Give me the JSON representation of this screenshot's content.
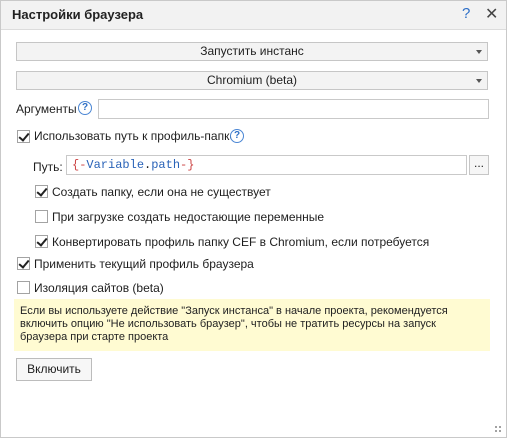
{
  "dialog": {
    "title": "Настройки браузера",
    "help_symbol": "?",
    "close_symbol": "✕"
  },
  "launch_combo": {
    "value": "Запустить инстанс"
  },
  "browser_combo": {
    "value": "Chromium (beta)"
  },
  "arguments": {
    "label": "Аргументы",
    "help": "?",
    "value": ""
  },
  "profile_folder": {
    "label": "Использовать путь к профиль-папке",
    "checked": true,
    "help": "?"
  },
  "path": {
    "label": "Путь:",
    "open_brace": "{-",
    "var_name": "Variable",
    "dot": ".",
    "var_field": "path",
    "close_brace": "-}",
    "browse_label": "..."
  },
  "options": [
    {
      "label": "Создать папку, если она не существует",
      "checked": true
    },
    {
      "label": "При загрузке создать недостающие переменные",
      "checked": false
    },
    {
      "label": "Конвертировать профиль папку CEF в Chromium, если потребуется",
      "checked": true
    },
    {
      "label": "Применить текущий профиль браузера",
      "checked": true
    },
    {
      "label": "Изоляция сайтов (beta)",
      "checked": false
    }
  ],
  "note": {
    "line1": "Если вы используете действие \"Запуск инстанса\" в начале проекта, рекомендуется",
    "line2": "включить опцию \"Не использовать браузер\", чтобы не тратить ресурсы на запуск",
    "line3": "браузера при старте проекта"
  },
  "enable_button": {
    "label": "Включить"
  }
}
